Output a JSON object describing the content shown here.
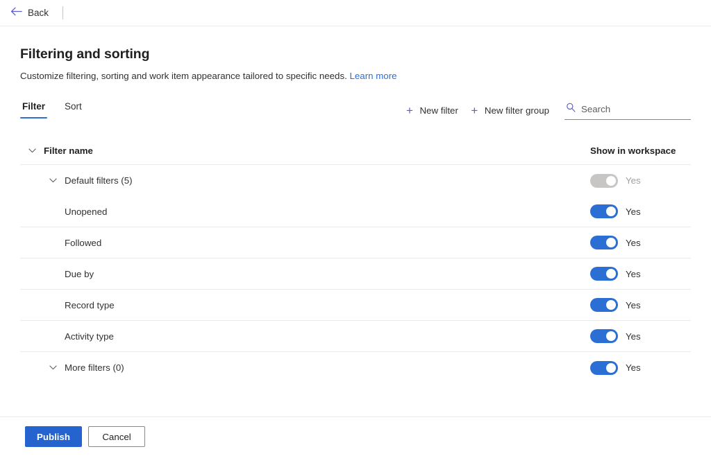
{
  "topbar": {
    "back_label": "Back",
    "back_icon": "arrow-left-icon",
    "accent": "#5b5fc7"
  },
  "page": {
    "title": "Filtering and sorting",
    "subtitle": "Customize filtering, sorting and work item appearance tailored to specific needs.",
    "learn_more": "Learn more"
  },
  "tabs": [
    {
      "label": "Filter",
      "selected": true
    },
    {
      "label": "Sort",
      "selected": false
    }
  ],
  "commands": [
    {
      "label": "New filter",
      "icon": "plus-icon"
    },
    {
      "label": "New filter group",
      "icon": "plus-icon"
    }
  ],
  "search": {
    "placeholder": "Search",
    "value": "",
    "icon": "search-icon"
  },
  "grid": {
    "columns": {
      "name": "Filter name",
      "toggle": "Show in workspace"
    },
    "header_chevron": "chevron-down-icon",
    "rows": [
      {
        "label": "Default filters (5)",
        "level": 1,
        "expandable": true,
        "chevron": "chevron-down-icon",
        "toggle_on": true,
        "toggle_disabled": true,
        "toggle_label": "Yes",
        "border": false
      },
      {
        "label": "Unopened",
        "level": 2,
        "expandable": false,
        "chevron": "",
        "toggle_on": true,
        "toggle_disabled": false,
        "toggle_label": "Yes",
        "border": true
      },
      {
        "label": "Followed",
        "level": 2,
        "expandable": false,
        "chevron": "",
        "toggle_on": true,
        "toggle_disabled": false,
        "toggle_label": "Yes",
        "border": true
      },
      {
        "label": "Due by",
        "level": 2,
        "expandable": false,
        "chevron": "",
        "toggle_on": true,
        "toggle_disabled": false,
        "toggle_label": "Yes",
        "border": true
      },
      {
        "label": "Record type",
        "level": 2,
        "expandable": false,
        "chevron": "",
        "toggle_on": true,
        "toggle_disabled": false,
        "toggle_label": "Yes",
        "border": true
      },
      {
        "label": "Activity type",
        "level": 2,
        "expandable": false,
        "chevron": "",
        "toggle_on": true,
        "toggle_disabled": false,
        "toggle_label": "Yes",
        "border": true
      },
      {
        "label": "More filters (0)",
        "level": 1,
        "expandable": true,
        "chevron": "chevron-down-icon",
        "toggle_on": true,
        "toggle_disabled": false,
        "toggle_label": "Yes",
        "border": false
      }
    ]
  },
  "footer": {
    "publish_label": "Publish",
    "cancel_label": "Cancel"
  },
  "colors": {
    "accent_blue": "#2b6fd4",
    "primary_button": "#2564cf",
    "link": "#2b6fd4",
    "icon_purple": "#5b5fc7",
    "divider": "#edebe9",
    "toggle_disabled": "#c8c6c4"
  }
}
